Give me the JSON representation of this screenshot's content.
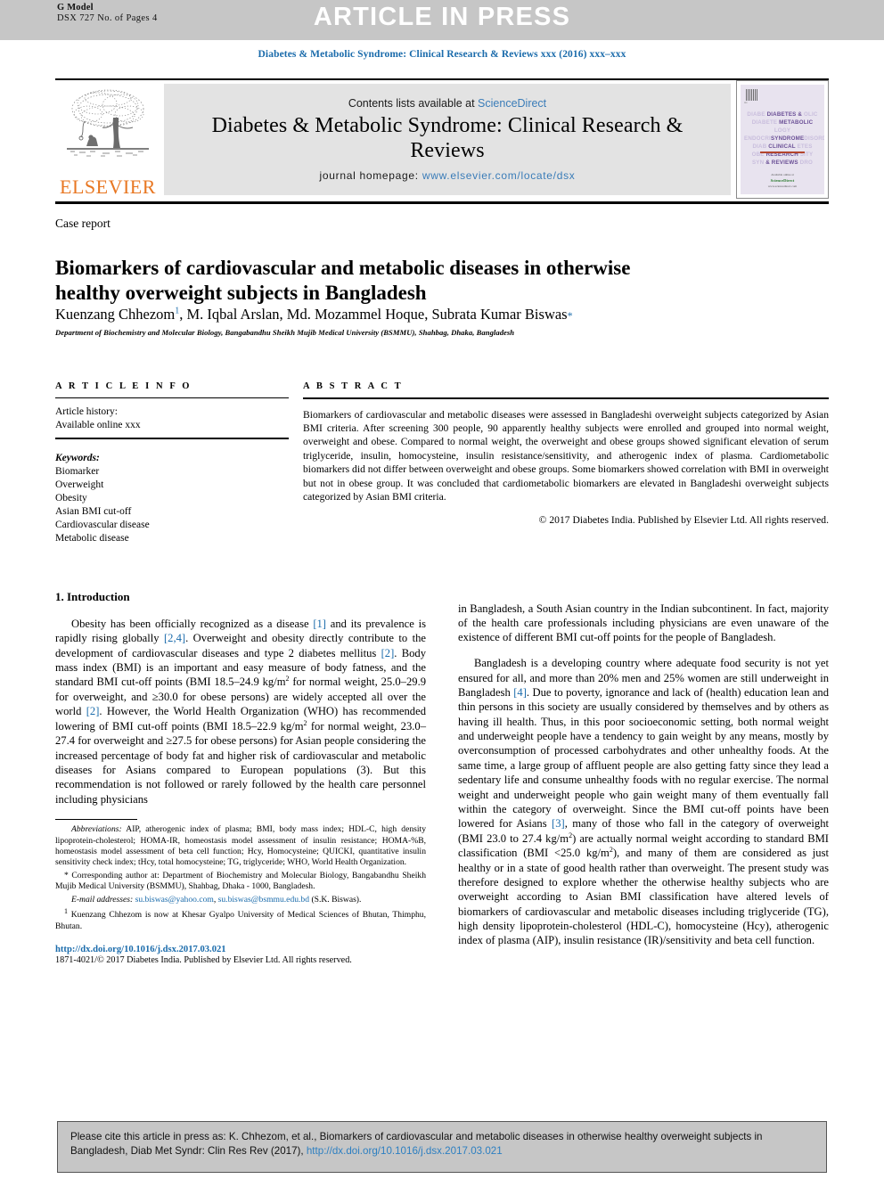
{
  "banner": {
    "g_model_label": "G Model",
    "g_model_sub": "DSX 727 No. of Pages 4",
    "title": "ARTICLE IN PRESS",
    "bg_color": "#c6c6c6"
  },
  "running_head": "Diabetes & Metabolic Syndrome: Clinical Research & Reviews xxx (2016) xxx–xxx",
  "masthead": {
    "publisher_wordmark": "ELSEVIER",
    "publisher_color": "#E87722",
    "contents_prefix": "Contents lists available at ",
    "contents_link": "ScienceDirect",
    "journal_name": "Diabetes & Metabolic Syndrome: Clinical Research & Reviews",
    "homepage_prefix": "journal homepage: ",
    "homepage_url": "www.elsevier.com/locate/dsx",
    "link_color": "#3a7cb8",
    "cover": {
      "line1_ghost_left": "DIABETES",
      "line1": "DIABETES &",
      "line2": "METABOLIC",
      "line3": "SYNDROME",
      "line4": "CLINICAL",
      "line5": "RESEARCH",
      "line6": "& REVIEWS",
      "footer_label": "Available online at",
      "footer_brand": "ScienceDirect",
      "footer_url": "www.sciencedirect.com"
    }
  },
  "article": {
    "type": "Case report",
    "title": "Biomarkers of cardiovascular and metabolic diseases in otherwise healthy overweight subjects in Bangladesh",
    "authors_html": "Kuenzang Chhezom<sup>1</sup>, M. Iqbal Arslan, Md. Mozammel Hoque, Subrata Kumar Biswas<span class=\"star\">*</span>",
    "affiliation": "Department of Biochemistry and Molecular Biology, Bangabandhu Sheikh Mujib Medical University (BSMMU), Shahbag, Dhaka, Bangladesh"
  },
  "article_info": {
    "heading": "A R T I C L E  I N F O",
    "history_label": "Article history:",
    "history_value": "Available online xxx",
    "keywords_label": "Keywords:",
    "keywords": [
      "Biomarker",
      "Overweight",
      "Obesity",
      "Asian BMI cut-off",
      "Cardiovascular disease",
      "Metabolic disease"
    ]
  },
  "abstract": {
    "heading": "A B S T R A C T",
    "body": "Biomarkers of cardiovascular and metabolic diseases were assessed in Bangladeshi overweight subjects categorized by Asian BMI criteria. After screening 300 people, 90 apparently healthy subjects were enrolled and grouped into normal weight, overweight and obese. Compared to normal weight, the overweight and obese groups showed significant elevation of serum triglyceride, insulin, homocysteine, insulin resistance/sensitivity, and atherogenic index of plasma. Cardiometabolic biomarkers did not differ between overweight and obese groups. Some biomarkers showed correlation with BMI in overweight but not in obese group. It was concluded that cardiometabolic biomarkers are elevated in Bangladeshi overweight subjects categorized by Asian BMI criteria.",
    "copyright": "© 2017 Diabetes India. Published by Elsevier Ltd. All rights reserved."
  },
  "introduction": {
    "section_title": "1. Introduction",
    "left_para_1_parts": {
      "a": "Obesity has been officially recognized as a disease ",
      "r1": "[1]",
      "b": " and its prevalence is rapidly rising globally ",
      "r2": "[2,4]",
      "c": ". Overweight and obesity directly contribute to the development of cardiovascular diseases and type 2 diabetes mellitus ",
      "r3": "[2]",
      "d": ". Body mass index (BMI) is an important and easy measure of body fatness, and the standard BMI cut-off points (BMI 18.5–24.9 kg/m",
      "sup1": "2",
      "e": " for normal weight, 25.0–29.9 for overweight, and ≥30.0 for obese persons) are widely accepted all over the world ",
      "r4": "[2]",
      "f": ". However, the World Health Organization (WHO) has recommended lowering of BMI cut-off points (BMI 18.5–22.9 kg/m",
      "sup2": "2",
      "g": " for normal weight, 23.0–27.4 for overweight and ≥27.5 for obese persons) for Asian people considering the increased percentage of body fat and higher risk of cardiovascular and metabolic diseases for Asians compared to European populations (3). But this recommendation is not followed or rarely followed by the health care personnel including physicians"
    },
    "right_para_1_continuation": "in Bangladesh, a South Asian country in the Indian subcontinent. In fact, majority of the health care professionals including physicians are even unaware of the existence of different BMI cut-off points for the people of Bangladesh.",
    "right_para_2_parts": {
      "a": "Bangladesh is a developing country where adequate food security is not yet ensured for all, and more than 20% men and 25% women are still underweight in Bangladesh ",
      "r1": "[4]",
      "b": ". Due to poverty, ignorance and lack of (health) education lean and thin persons in this society are usually considered by themselves and by others as having ill health. Thus, in this poor socioeconomic setting, both normal weight and underweight people have a tendency to gain weight by any means, mostly by overconsumption of processed carbohydrates and other unhealthy foods. At the same time, a large group of affluent people are also getting fatty since they lead a sedentary life and consume unhealthy foods with no regular exercise. The normal weight and underweight people who gain weight many of them eventually fall within the category of overweight. Since the BMI cut-off points have been lowered for Asians ",
      "r2": "[3]",
      "c": ", many of those who fall in the category of overweight (BMI 23.0 to 27.4 kg/m",
      "sup1": "2",
      "d": ") are actually normal weight according to standard BMI classification (BMI <25.0 kg/m",
      "sup2": "2",
      "e": "), and many of them are considered as just healthy or in a state of good health rather than overweight. The present study was therefore designed to explore whether the otherwise healthy subjects who are overweight according to Asian BMI classification have altered levels of biomarkers of cardiovascular and metabolic diseases including triglyceride (TG), high density lipoprotein-cholesterol (HDL-C), homocysteine (Hcy), atherogenic index of plasma (AIP), insulin resistance (IR)/sensitivity and beta cell function."
    }
  },
  "footnotes": {
    "abbreviations_label": "Abbreviations:",
    "abbreviations_text": " AIP, atherogenic index of plasma; BMI, body mass index; HDL-C, high density lipoprotein-cholesterol; HOMA-IR, homeostasis model assessment of insulin resistance; HOMA-%B, homeostasis model assessment of beta cell function; Hcy, Homocysteine; QUICKI, quantitative insulin sensitivity check index; tHcy, total homocysteine; TG, triglyceride; WHO, World Health Organization.",
    "corresponding_marker": "*",
    "corresponding_text": " Corresponding author at: Department of Biochemistry and Molecular Biology, Bangabandhu Sheikh Mujib Medical University (BSMMU), Shahbag, Dhaka - 1000, Bangladesh.",
    "email_label": "E-mail addresses:",
    "email_1": "su.biswas@yahoo.com",
    "email_2": "su.biswas@bsmmu.edu.bd",
    "email_owner": "(S.K. Biswas).",
    "note1_marker": "1",
    "note1_text": " Kuenzang Chhezom is now at Khesar Gyalpo University of Medical Sciences of Bhutan, Thimphu, Bhutan.",
    "doi_url": "http://dx.doi.org/10.1016/j.dsx.2017.03.021",
    "issn_line": "1871-4021/© 2017 Diabetes India. Published by Elsevier Ltd. All rights reserved."
  },
  "citation_box": {
    "text_before_link": "Please cite this article in press as: K. Chhezom, et al., Biomarkers of cardiovascular and metabolic diseases in otherwise healthy overweight subjects in Bangladesh, Diab Met Syndr: Clin Res Rev (2017), ",
    "link": "http://dx.doi.org/10.1016/j.dsx.2017.03.021",
    "bg_color": "#c6c6c6",
    "link_color": "#2d7fc1"
  }
}
